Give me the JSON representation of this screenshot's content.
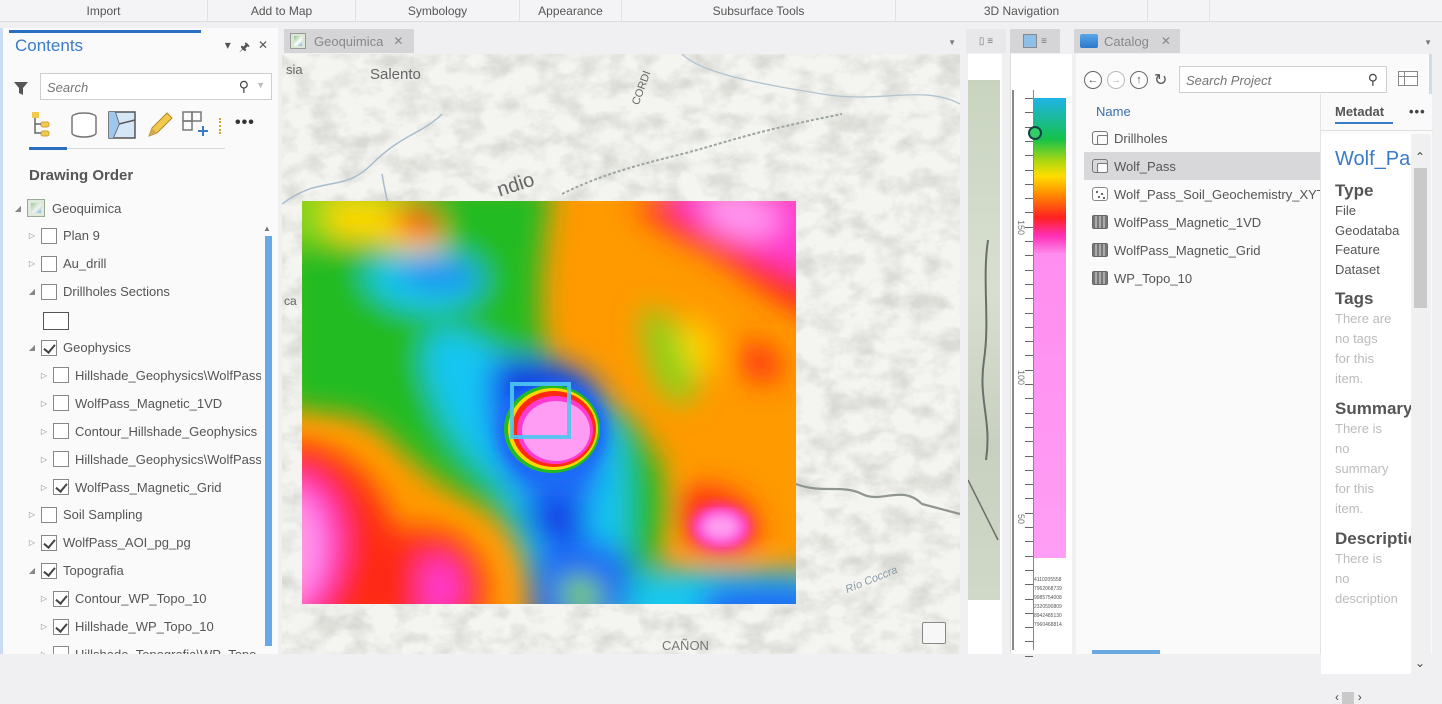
{
  "ribbon": {
    "groups": [
      "Import",
      "Add to Map",
      "Symbology",
      "Appearance",
      "Subsurface Tools",
      "3D Navigation"
    ]
  },
  "contents": {
    "title": "Contents",
    "search_placeholder": "Search",
    "section_title": "Drawing Order",
    "tools": [
      "list-by-drawing-order",
      "list-by-source",
      "list-by-selection",
      "list-by-editing",
      "list-by-snapping",
      "more-options"
    ],
    "tree": [
      {
        "label": "Geoquimica",
        "level": 0,
        "expand": "open",
        "type": "map"
      },
      {
        "label": "Plan 9",
        "level": 1,
        "expand": "closed",
        "checked": false
      },
      {
        "label": "Au_drill",
        "level": 1,
        "expand": "closed",
        "checked": false
      },
      {
        "label": "Drillholes Sections",
        "level": 1,
        "expand": "open",
        "checked": false
      },
      {
        "label": "Geophysics",
        "level": 1,
        "expand": "open",
        "checked": true
      },
      {
        "label": "Hillshade_Geophysics\\WolfPass",
        "level": 2,
        "expand": "closed",
        "checked": false
      },
      {
        "label": "WolfPass_Magnetic_1VD",
        "level": 2,
        "expand": "closed",
        "checked": false
      },
      {
        "label": "Contour_Hillshade_Geophysics",
        "level": 2,
        "expand": "closed",
        "checked": false
      },
      {
        "label": "Hillshade_Geophysics\\WolfPass",
        "level": 2,
        "expand": "closed",
        "checked": false
      },
      {
        "label": "WolfPass_Magnetic_Grid",
        "level": 2,
        "expand": "closed",
        "checked": true
      },
      {
        "label": "Soil Sampling",
        "level": 1,
        "expand": "closed",
        "checked": false
      },
      {
        "label": "WolfPass_AOI_pg_pg",
        "level": 1,
        "expand": "closed",
        "checked": true
      },
      {
        "label": "Topografia",
        "level": 1,
        "expand": "open",
        "checked": true
      },
      {
        "label": "Contour_WP_Topo_10",
        "level": 2,
        "expand": "closed",
        "checked": true
      },
      {
        "label": "Hillshade_WP_Topo_10",
        "level": 2,
        "expand": "closed",
        "checked": true
      },
      {
        "label": "Hillshade_Topografia\\WP_Topo",
        "level": 2,
        "expand": "closed",
        "checked": false
      }
    ]
  },
  "map": {
    "tab_label": "Geoquimica",
    "labels": {
      "salento": "Salento",
      "sia": "sia",
      "cordillera": "CORDI",
      "quindio": "ndio",
      "canon": "CAÑON",
      "rio": "Río Coccra",
      "ca": "ca"
    }
  },
  "section_view": {
    "ruler_labels": [
      "150",
      "100",
      "50"
    ],
    "values": [
      "4110205558",
      "7962068739",
      "9985754008",
      "2320590809",
      "8942485130",
      "7960468814"
    ]
  },
  "catalog": {
    "tab_label": "Catalog",
    "search_placeholder": "Search Project",
    "column_header": "Name",
    "items": [
      {
        "label": "Drillholes",
        "icon": "feature-dataset",
        "selected": false
      },
      {
        "label": "Wolf_Pass",
        "icon": "feature-dataset",
        "selected": true
      },
      {
        "label": "Wolf_Pass_Soil_Geochemistry_XYTable",
        "icon": "point-feature-class",
        "selected": false
      },
      {
        "label": "WolfPass_Magnetic_1VD",
        "icon": "raster",
        "selected": false
      },
      {
        "label": "WolfPass_Magnetic_Grid",
        "icon": "raster",
        "selected": false
      },
      {
        "label": "WP_Topo_10",
        "icon": "raster",
        "selected": false
      }
    ],
    "metadata": {
      "tab_label": "Metadat",
      "title": "Wolf_Pass",
      "type_heading": "Type",
      "type_lines": [
        "File",
        "Geodataba",
        "Feature",
        "Dataset"
      ],
      "tags_heading": "Tags",
      "tags_empty": [
        "There are",
        "no tags",
        "for this",
        "item."
      ],
      "summary_heading": "Summary",
      "summary_empty": [
        "There is",
        "no",
        "summary",
        "for this",
        "item."
      ],
      "description_heading": "Description",
      "description_empty": [
        "There is",
        "no",
        "description"
      ]
    }
  },
  "colors": {
    "accent": "#3a7bc8",
    "selection": "#d8d8da",
    "scroll_thumb": "#67a9e6"
  }
}
